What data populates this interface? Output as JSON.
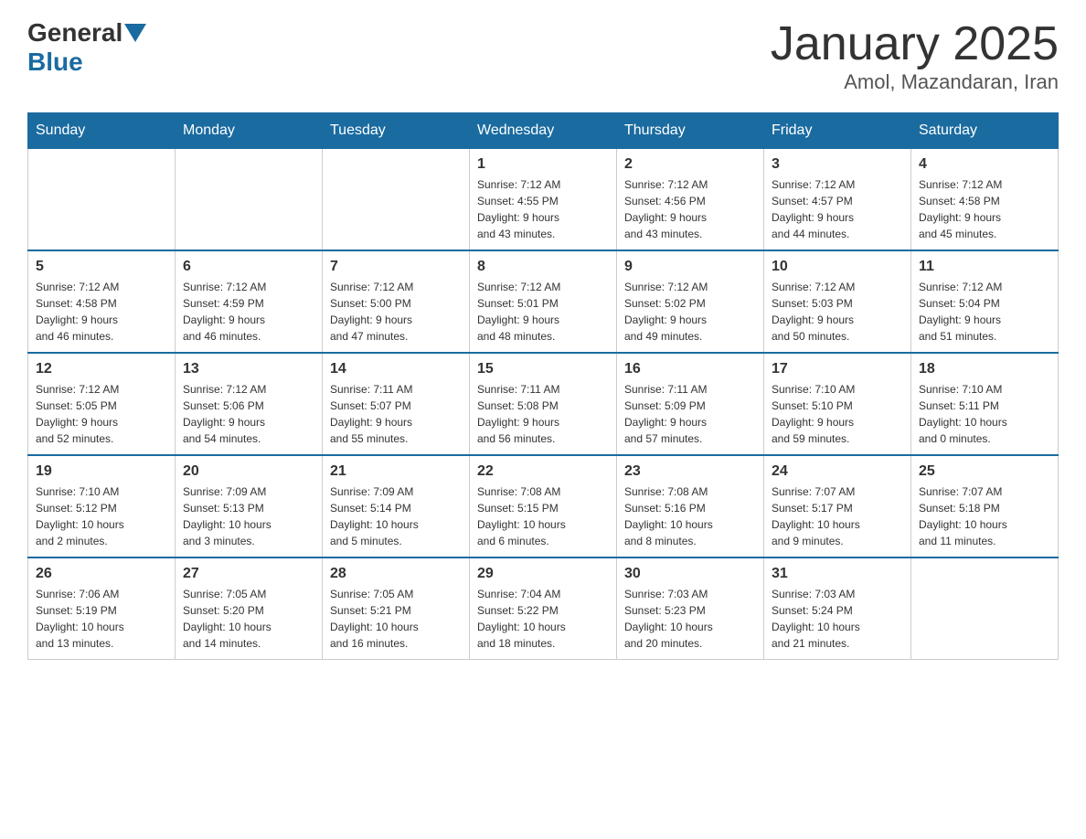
{
  "header": {
    "logo_text_general": "General",
    "logo_text_blue": "Blue",
    "month_title": "January 2025",
    "location": "Amol, Mazandaran, Iran"
  },
  "weekdays": [
    "Sunday",
    "Monday",
    "Tuesday",
    "Wednesday",
    "Thursday",
    "Friday",
    "Saturday"
  ],
  "weeks": [
    [
      {
        "day": "",
        "info": ""
      },
      {
        "day": "",
        "info": ""
      },
      {
        "day": "",
        "info": ""
      },
      {
        "day": "1",
        "info": "Sunrise: 7:12 AM\nSunset: 4:55 PM\nDaylight: 9 hours\nand 43 minutes."
      },
      {
        "day": "2",
        "info": "Sunrise: 7:12 AM\nSunset: 4:56 PM\nDaylight: 9 hours\nand 43 minutes."
      },
      {
        "day": "3",
        "info": "Sunrise: 7:12 AM\nSunset: 4:57 PM\nDaylight: 9 hours\nand 44 minutes."
      },
      {
        "day": "4",
        "info": "Sunrise: 7:12 AM\nSunset: 4:58 PM\nDaylight: 9 hours\nand 45 minutes."
      }
    ],
    [
      {
        "day": "5",
        "info": "Sunrise: 7:12 AM\nSunset: 4:58 PM\nDaylight: 9 hours\nand 46 minutes."
      },
      {
        "day": "6",
        "info": "Sunrise: 7:12 AM\nSunset: 4:59 PM\nDaylight: 9 hours\nand 46 minutes."
      },
      {
        "day": "7",
        "info": "Sunrise: 7:12 AM\nSunset: 5:00 PM\nDaylight: 9 hours\nand 47 minutes."
      },
      {
        "day": "8",
        "info": "Sunrise: 7:12 AM\nSunset: 5:01 PM\nDaylight: 9 hours\nand 48 minutes."
      },
      {
        "day": "9",
        "info": "Sunrise: 7:12 AM\nSunset: 5:02 PM\nDaylight: 9 hours\nand 49 minutes."
      },
      {
        "day": "10",
        "info": "Sunrise: 7:12 AM\nSunset: 5:03 PM\nDaylight: 9 hours\nand 50 minutes."
      },
      {
        "day": "11",
        "info": "Sunrise: 7:12 AM\nSunset: 5:04 PM\nDaylight: 9 hours\nand 51 minutes."
      }
    ],
    [
      {
        "day": "12",
        "info": "Sunrise: 7:12 AM\nSunset: 5:05 PM\nDaylight: 9 hours\nand 52 minutes."
      },
      {
        "day": "13",
        "info": "Sunrise: 7:12 AM\nSunset: 5:06 PM\nDaylight: 9 hours\nand 54 minutes."
      },
      {
        "day": "14",
        "info": "Sunrise: 7:11 AM\nSunset: 5:07 PM\nDaylight: 9 hours\nand 55 minutes."
      },
      {
        "day": "15",
        "info": "Sunrise: 7:11 AM\nSunset: 5:08 PM\nDaylight: 9 hours\nand 56 minutes."
      },
      {
        "day": "16",
        "info": "Sunrise: 7:11 AM\nSunset: 5:09 PM\nDaylight: 9 hours\nand 57 minutes."
      },
      {
        "day": "17",
        "info": "Sunrise: 7:10 AM\nSunset: 5:10 PM\nDaylight: 9 hours\nand 59 minutes."
      },
      {
        "day": "18",
        "info": "Sunrise: 7:10 AM\nSunset: 5:11 PM\nDaylight: 10 hours\nand 0 minutes."
      }
    ],
    [
      {
        "day": "19",
        "info": "Sunrise: 7:10 AM\nSunset: 5:12 PM\nDaylight: 10 hours\nand 2 minutes."
      },
      {
        "day": "20",
        "info": "Sunrise: 7:09 AM\nSunset: 5:13 PM\nDaylight: 10 hours\nand 3 minutes."
      },
      {
        "day": "21",
        "info": "Sunrise: 7:09 AM\nSunset: 5:14 PM\nDaylight: 10 hours\nand 5 minutes."
      },
      {
        "day": "22",
        "info": "Sunrise: 7:08 AM\nSunset: 5:15 PM\nDaylight: 10 hours\nand 6 minutes."
      },
      {
        "day": "23",
        "info": "Sunrise: 7:08 AM\nSunset: 5:16 PM\nDaylight: 10 hours\nand 8 minutes."
      },
      {
        "day": "24",
        "info": "Sunrise: 7:07 AM\nSunset: 5:17 PM\nDaylight: 10 hours\nand 9 minutes."
      },
      {
        "day": "25",
        "info": "Sunrise: 7:07 AM\nSunset: 5:18 PM\nDaylight: 10 hours\nand 11 minutes."
      }
    ],
    [
      {
        "day": "26",
        "info": "Sunrise: 7:06 AM\nSunset: 5:19 PM\nDaylight: 10 hours\nand 13 minutes."
      },
      {
        "day": "27",
        "info": "Sunrise: 7:05 AM\nSunset: 5:20 PM\nDaylight: 10 hours\nand 14 minutes."
      },
      {
        "day": "28",
        "info": "Sunrise: 7:05 AM\nSunset: 5:21 PM\nDaylight: 10 hours\nand 16 minutes."
      },
      {
        "day": "29",
        "info": "Sunrise: 7:04 AM\nSunset: 5:22 PM\nDaylight: 10 hours\nand 18 minutes."
      },
      {
        "day": "30",
        "info": "Sunrise: 7:03 AM\nSunset: 5:23 PM\nDaylight: 10 hours\nand 20 minutes."
      },
      {
        "day": "31",
        "info": "Sunrise: 7:03 AM\nSunset: 5:24 PM\nDaylight: 10 hours\nand 21 minutes."
      },
      {
        "day": "",
        "info": ""
      }
    ]
  ]
}
